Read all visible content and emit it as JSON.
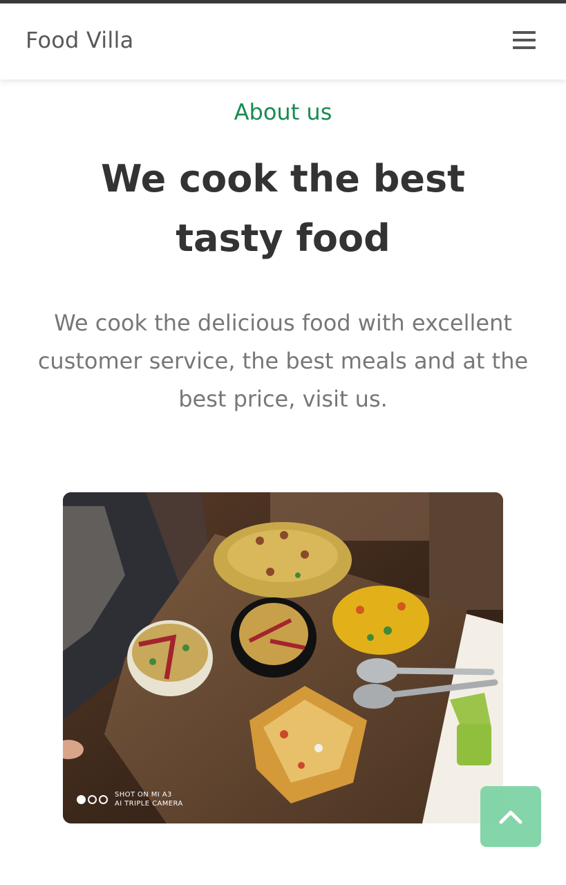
{
  "navbar": {
    "brand": "Food Villa",
    "menu_icon": "hamburger-menu-icon"
  },
  "about": {
    "label": "About us",
    "headline_line1": "We cook the best",
    "headline_line2": "tasty food",
    "description": "We cook the delicious food with excellent customer service, the best meals and at the best price, visit us."
  },
  "photo": {
    "watermark_line1": "SHOT ON MI A3",
    "watermark_line2": "AI TRIPLE CAMERA"
  },
  "scroll_top": {
    "icon": "chevron-up-icon"
  },
  "colors": {
    "accent_green": "#1a8a52",
    "scroll_button": "#7ed3a5",
    "heading": "#333333",
    "body_text": "#777777"
  }
}
